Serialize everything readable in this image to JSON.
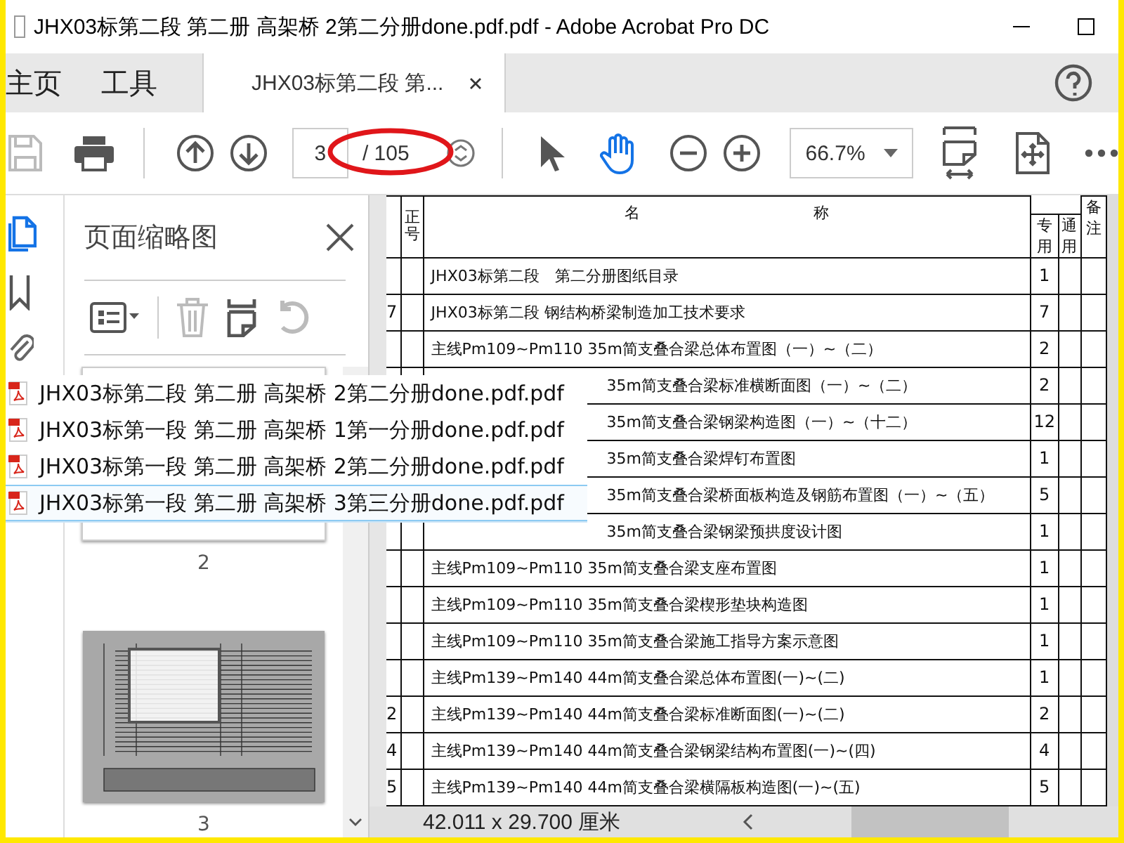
{
  "window": {
    "title": "JHX03标第二段 第二册 高架桥 2第二分册done.pdf.pdf - Adobe Acrobat Pro DC"
  },
  "tabs": [
    {
      "label": "主页",
      "selected": false
    },
    {
      "label": "工具",
      "selected": false
    },
    {
      "label": "JHX03标第二段 第...",
      "selected": true
    }
  ],
  "toolbar": {
    "page_field": {
      "value": "3"
    },
    "page_total": "/ 105",
    "zoom": "66.7%"
  },
  "thumbnail_panel": {
    "title": "页面缩略图",
    "thumbnails": [
      {
        "page": "2"
      },
      {
        "page": "3"
      }
    ]
  },
  "recent_files": [
    {
      "name": "JHX03标第二段 第二册 高架桥 2第二分册done.pdf.pdf",
      "selected": false
    },
    {
      "name": "JHX03标第一段 第二册 高架桥 1第一分册done.pdf.pdf",
      "selected": false
    },
    {
      "name": "JHX03标第一段 第二册 高架桥 2第二分册done.pdf.pdf",
      "selected": false
    },
    {
      "name": "JHX03标第一段 第二册 高架桥 3第三分册done.pdf.pdf",
      "selected": true
    }
  ],
  "table": {
    "columns": [
      "正号",
      "名 称",
      "专用",
      "通用",
      "备注"
    ],
    "rows": [
      {
        "name": "JHX03标第二段　第二分册图纸目录",
        "count": "1",
        "covered": false
      },
      {
        "column_1": "7",
        "name": "JHX03标第二段 钢结构桥梁制造加工技术要求",
        "count": "7",
        "covered": false
      },
      {
        "name": "主线Pm109~Pm110 35m简支叠合梁总体布置图（一）~（二）",
        "count": "2",
        "covered": false
      },
      {
        "name": "35m简支叠合梁标准横断面图（一）~（二）",
        "count": "2",
        "covered": true
      },
      {
        "name": "35m简支叠合梁钢梁构造图（一）~（十二）",
        "count": "12",
        "covered": true
      },
      {
        "name": "35m简支叠合梁焊钉布置图",
        "count": "1",
        "covered": true
      },
      {
        "name": "35m简支叠合梁桥面板构造及钢筋布置图（一）~（五）",
        "count": "5",
        "covered": true
      },
      {
        "name": "35m简支叠合梁钢梁预拱度设计图",
        "count": "1",
        "covered": true
      },
      {
        "name": "主线Pm109~Pm110 35m简支叠合梁支座布置图",
        "count": "1",
        "covered": false
      },
      {
        "name": "主线Pm109~Pm110 35m简支叠合梁楔形垫块构造图",
        "count": "1",
        "covered": false
      },
      {
        "name": "主线Pm109~Pm110 35m简支叠合梁施工指导方案示意图",
        "count": "1",
        "covered": false
      },
      {
        "name": "主线Pm139~Pm140 44m简支叠合梁总体布置图(一)~(二)",
        "count": "1",
        "covered": false
      },
      {
        "column_1": "2",
        "name": "主线Pm139~Pm140 44m简支叠合梁标准断面图(一)~(二)",
        "count": "2",
        "covered": false
      },
      {
        "column_1": "4",
        "name": "主线Pm139~Pm140 44m简支叠合梁钢梁结构布置图(一)~(四)",
        "count": "4",
        "covered": false
      },
      {
        "column_1": "5",
        "name": "主线Pm139~Pm140 44m简支叠合梁横隔板构造图(一)~(五)",
        "count": "5",
        "covered": false
      }
    ]
  },
  "status_bar": {
    "page_size": "42.011 x 29.700 厘米"
  }
}
